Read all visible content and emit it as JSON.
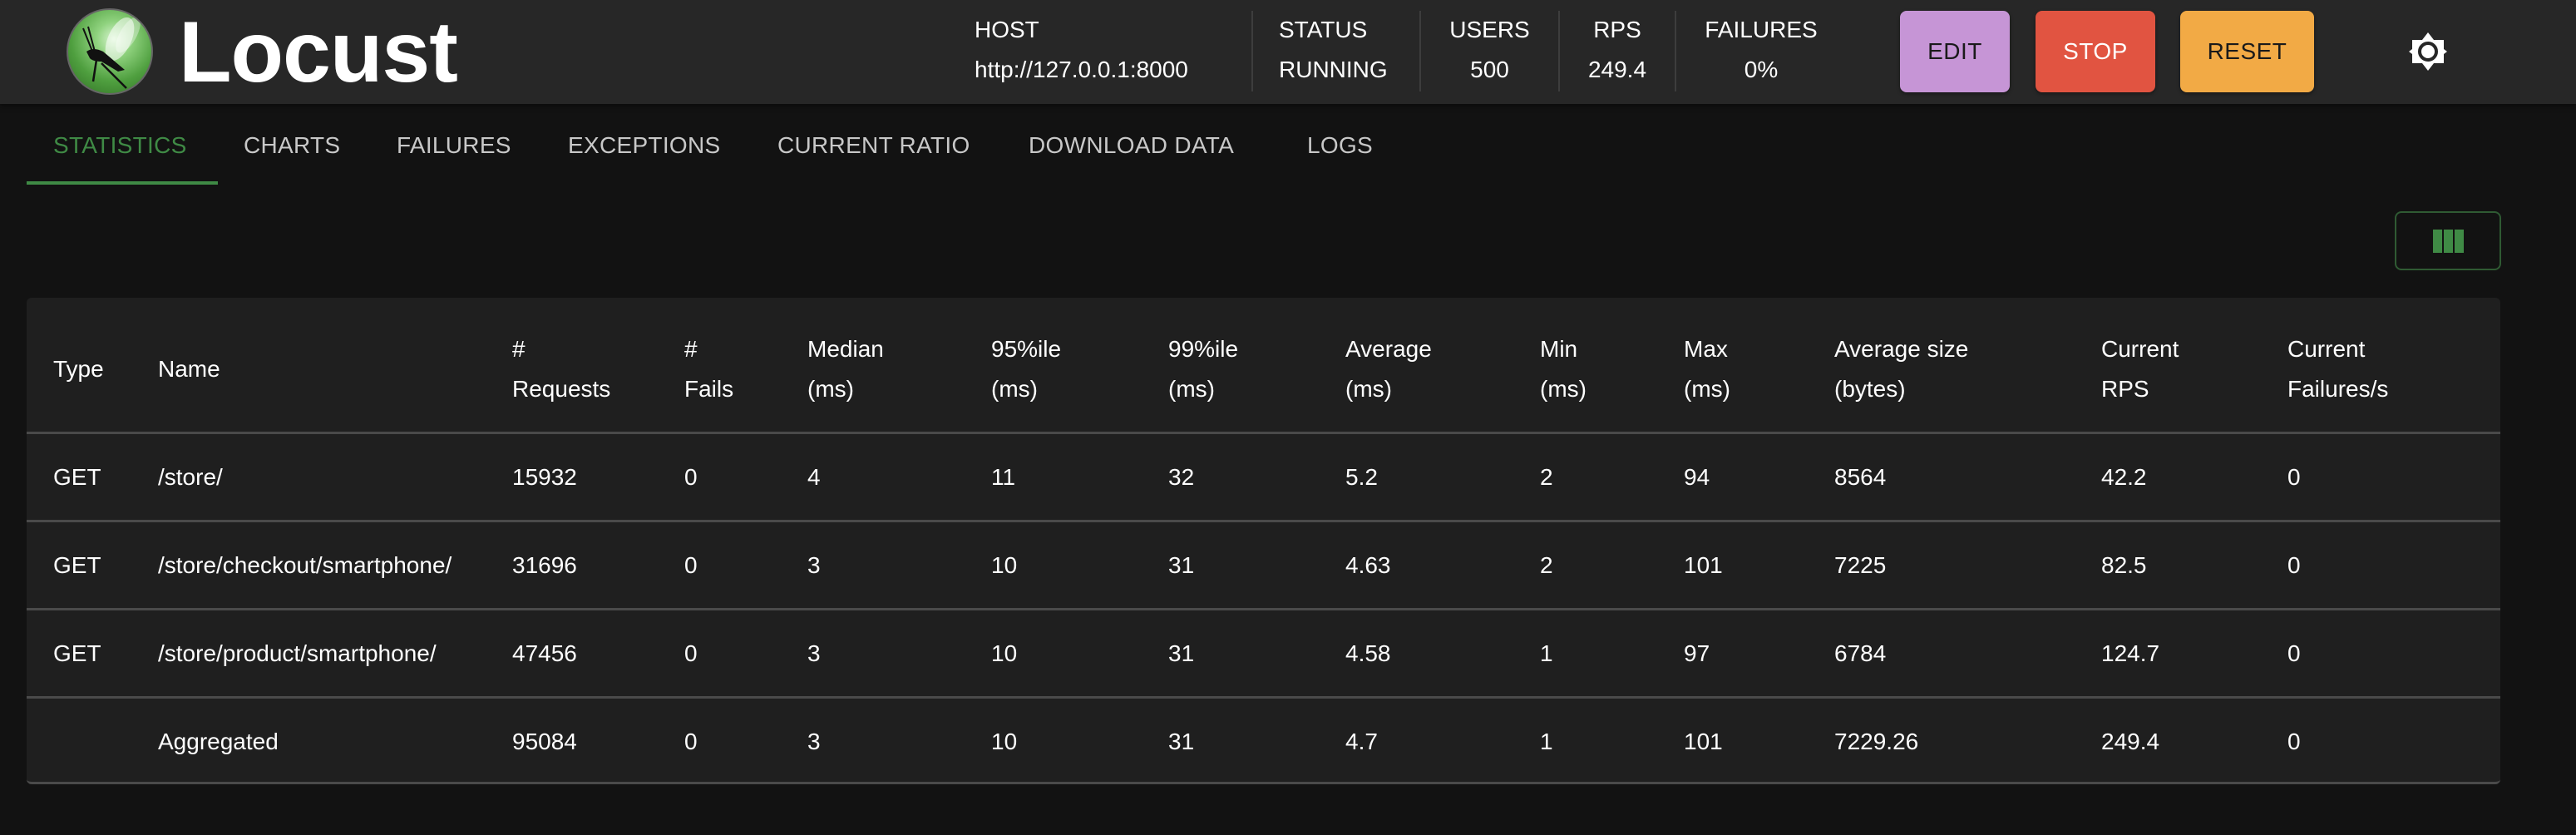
{
  "header": {
    "brand": "Locust",
    "stats": [
      {
        "label": "HOST",
        "value": "http://127.0.0.1:8000"
      },
      {
        "label": "STATUS",
        "value": "RUNNING"
      },
      {
        "label": "USERS",
        "value": "500"
      },
      {
        "label": "RPS",
        "value": "249.4"
      },
      {
        "label": "FAILURES",
        "value": "0%"
      }
    ],
    "buttons": {
      "edit": "EDIT",
      "stop": "STOP",
      "reset": "RESET"
    },
    "colors": {
      "edit": "#c695d6",
      "stop": "#e15441",
      "reset": "#f2aa45",
      "accent": "#3f8a45"
    }
  },
  "tabs": [
    {
      "label": "STATISTICS",
      "active": true
    },
    {
      "label": "CHARTS",
      "active": false
    },
    {
      "label": "FAILURES",
      "active": false
    },
    {
      "label": "EXCEPTIONS",
      "active": false
    },
    {
      "label": "CURRENT RATIO",
      "active": false
    },
    {
      "label": "DOWNLOAD DATA",
      "active": false
    },
    {
      "label": "LOGS",
      "active": false
    }
  ],
  "table": {
    "columns": [
      {
        "line1": "Type",
        "line2": ""
      },
      {
        "line1": "Name",
        "line2": ""
      },
      {
        "line1": "#",
        "line2": "Requests"
      },
      {
        "line1": "#",
        "line2": "Fails"
      },
      {
        "line1": "Median",
        "line2": "(ms)"
      },
      {
        "line1": "95%ile",
        "line2": "(ms)"
      },
      {
        "line1": "99%ile",
        "line2": "(ms)"
      },
      {
        "line1": "Average",
        "line2": "(ms)"
      },
      {
        "line1": "Min",
        "line2": "(ms)"
      },
      {
        "line1": "Max",
        "line2": "(ms)"
      },
      {
        "line1": "Average size",
        "line2": "(bytes)"
      },
      {
        "line1": "Current",
        "line2": "RPS"
      },
      {
        "line1": "Current",
        "line2": "Failures/s"
      }
    ],
    "rows": [
      [
        "GET",
        "/store/",
        "15932",
        "0",
        "4",
        "11",
        "32",
        "5.2",
        "2",
        "94",
        "8564",
        "42.2",
        "0"
      ],
      [
        "GET",
        "/store/checkout/smartphone/",
        "31696",
        "0",
        "3",
        "10",
        "31",
        "4.63",
        "2",
        "101",
        "7225",
        "82.5",
        "0"
      ],
      [
        "GET",
        "/store/product/smartphone/",
        "47456",
        "0",
        "3",
        "10",
        "31",
        "4.58",
        "1",
        "97",
        "6784",
        "124.7",
        "0"
      ],
      [
        "",
        "Aggregated",
        "95084",
        "0",
        "3",
        "10",
        "31",
        "4.7",
        "1",
        "101",
        "7229.26",
        "249.4",
        "0"
      ]
    ]
  }
}
